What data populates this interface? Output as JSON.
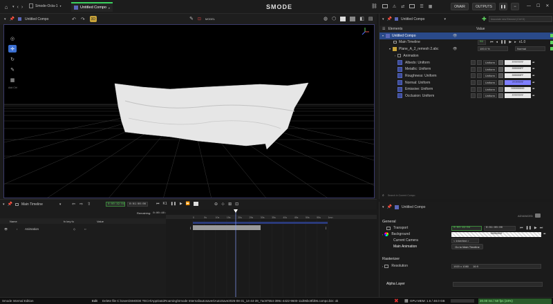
{
  "app": {
    "logo": "SMODE",
    "doc_tab": "Smode-Octa-1",
    "compo_tab": "Untitled Compo",
    "onair": "ONAIR",
    "outputs": "OUTPUTS",
    "accent": "#3bd35f"
  },
  "viewport": {
    "compo_name": "Untitled Compo",
    "model_label": "MODEL",
    "side_tools": [
      "select-icon",
      "move-icon",
      "rotate-icon",
      "edit-icon",
      "grid-icon"
    ],
    "side_label": "Add Ctrl"
  },
  "elements": {
    "title": "Elements",
    "panel_compo": "Untitled Compo",
    "search_placeholder": "Associate new Element (Ctrl+D)",
    "value_header": "Value",
    "rows": [
      {
        "label": "Untitled Compo",
        "depth": 0
      },
      {
        "label": "Main Timeline",
        "depth": 1,
        "value": "59",
        "rate": "x1.0"
      },
      {
        "label": "Plane_A_2_remesh 2.abc",
        "depth": 1,
        "value": "100.0 %",
        "mode": "Normal"
      },
      {
        "label": "Animation",
        "depth": 2
      }
    ],
    "params": [
      {
        "label": "Albedo: Uniform",
        "type": "Uniform",
        "hex": "FFFFFFFF",
        "highlight": false
      },
      {
        "label": "Metallic: Uniform",
        "type": "Uniform",
        "hex": "000000FF",
        "highlight": false
      },
      {
        "label": "Roughness: Uniform",
        "type": "Uniform",
        "hex": "000000FF",
        "highlight": false
      },
      {
        "label": "Normal: Uniform",
        "type": "Uniform",
        "hex": "7F7FFFFF",
        "highlight": true
      },
      {
        "label": "Emissive: Uniform",
        "type": "Uniform",
        "hex": "000000000",
        "highlight": false
      },
      {
        "label": "Occlusion: Uniform",
        "type": "Uniform",
        "hex": "FFFFFFFF",
        "highlight": false
      }
    ],
    "filter_placeholder": "Search in Current Compo"
  },
  "properties": {
    "compo": "Untitled Compo",
    "advanced": "ADVANCED",
    "general": "General",
    "transport_label": "Transport",
    "transport_time": "0:00:19:04",
    "transport_end": "0:01:00:00",
    "background_label": "Background",
    "background_hex": "00000000",
    "camera_label": "Current Camera",
    "camera_value": "< Inherited >",
    "main_anim_label": "Main Animation",
    "main_anim_button": "Go to Main Timeline",
    "rasterizer": "Rasterizer",
    "resolution_label": "Resolution",
    "resolution_value": "1920 x 1080",
    "aspect": "16:9",
    "alpha_label": "Alpha Layer"
  },
  "timeline": {
    "name": "Main Timeline",
    "time": "0:00:19:04",
    "end": "0:01:00:00",
    "remaining_label": "Remaining:",
    "remaining": "0:00:40:48",
    "col_name": "Name",
    "col_key": "fx  key fu",
    "col_value": "Value",
    "track": "Animation",
    "ruler": [
      "0",
      "5s",
      "10s",
      "15s",
      "20s",
      "25s",
      "30s",
      "35s",
      "40s",
      "45s",
      "50s",
      "55s",
      "1mn"
    ]
  },
  "status": {
    "edition": "Smode Internal Edition",
    "edit_label": "Edit",
    "message": "Delete file C:\\Users\\SMODE TECH\\AppData\\Roaming\\Smode Internal\\autosaves\\AutoSave2026-08-31_14-44-39_7ac97554-399c-4422-9600-11d06bc8fd06.compo.bin: ok",
    "gpu": "GPU MEM: 1.5 / 48.0 GB",
    "fps": "20.00 ms / 50 fps (24%)"
  }
}
